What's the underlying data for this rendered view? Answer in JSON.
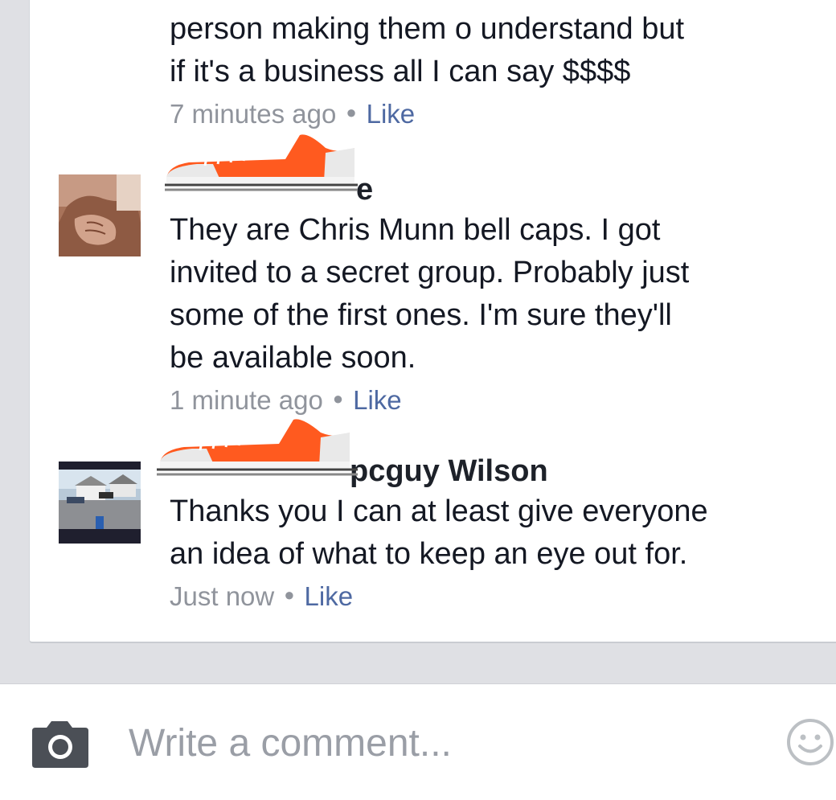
{
  "comments": [
    {
      "author": "",
      "text": "person making them o understand but\nif it's a business all I can say $$$$",
      "time": "7 minutes ago",
      "like": "Like"
    },
    {
      "author": "e",
      "text": "They are Chris Munn bell caps.   I got\ninvited to a secret group.  Probably just\nsome of the first ones.  I'm sure they'll\nbe available soon.",
      "time": "1 minute ago",
      "like": "Like"
    },
    {
      "author": "pcguy Wilson",
      "text": "Thanks you I can at least give everyone\nan idea of what to keep an eye  out for.",
      "time": "Just now",
      "like": "Like"
    }
  ],
  "composer": {
    "placeholder": "Write a comment..."
  },
  "icons": {
    "camera": "camera-icon",
    "emoji": "smiley-icon",
    "redaction": "sneaker-sticker"
  },
  "colors": {
    "link": "#4e69a2",
    "meta": "#90949c",
    "text": "#141823",
    "background": "#dfe0e4",
    "sticker": "#ff5a1f"
  }
}
